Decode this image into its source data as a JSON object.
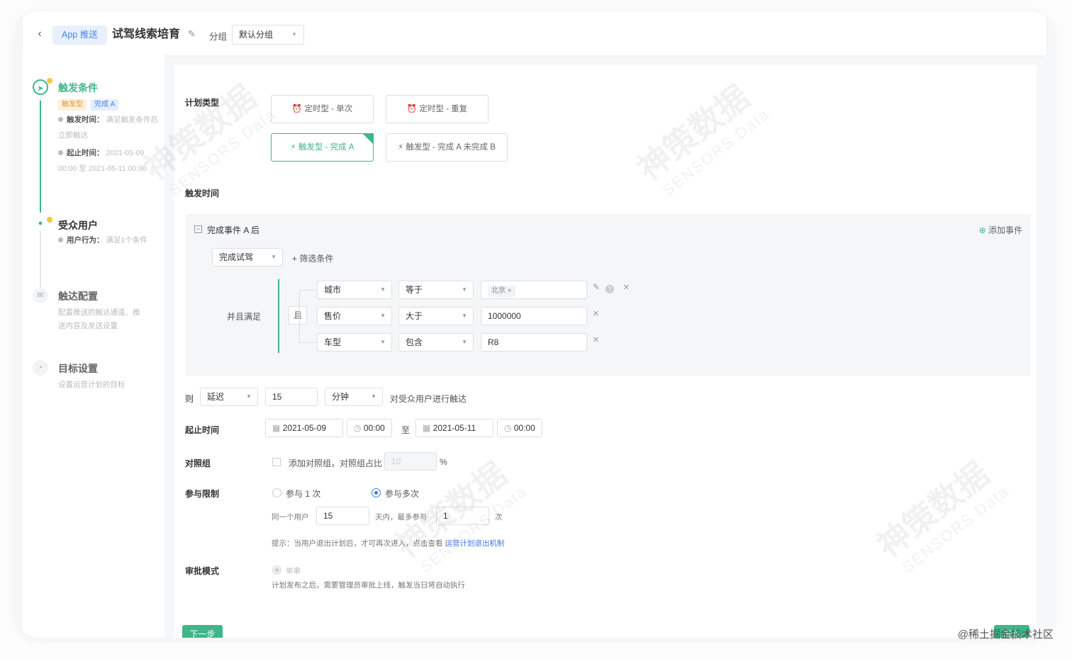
{
  "header": {
    "channel": "App 推送",
    "title": "试驾线索培育",
    "group_label": "分组",
    "group_value": "默认分组"
  },
  "steps": {
    "trigger": {
      "title": "触发条件",
      "badge1": "触发型",
      "badge2": "完成 A",
      "time_key": "触发时间：",
      "time_val": "满足触发条件后",
      "time_val2": "立即触达",
      "range_key": "起止时间：",
      "range_val": "2021-05-09",
      "range_val2": "00:00 至 2021-05-11 00:00"
    },
    "audience": {
      "title": "受众用户",
      "behavior_key": "用户行为：",
      "behavior_val": "满足1个条件"
    },
    "reach": {
      "title": "触达配置",
      "desc1": "配置推送的触达通道、推",
      "desc2": "送内容及发送设置"
    },
    "goal": {
      "title": "目标设置",
      "desc": "设置运营计划的目标"
    }
  },
  "form": {
    "plan_type_label": "计划类型",
    "plan_types": [
      "定时型 - 单次",
      "定时型 - 重复",
      "触发型 - 完成 A",
      "触发型 - 完成 A 未完成 B"
    ],
    "trigger_time_label": "触发时间",
    "cond": {
      "title": "完成事件 A 后",
      "add_event": "添加事件",
      "event": "完成试驾",
      "add_filter": "+ 筛选条件",
      "and_label": "并且满足",
      "and_op": "且",
      "rows": [
        {
          "field": "城市",
          "op": "等于",
          "value": "北京"
        },
        {
          "field": "售价",
          "op": "大于",
          "value": "1000000"
        },
        {
          "field": "车型",
          "op": "包含",
          "value": "R8"
        }
      ]
    },
    "then": {
      "label": "则",
      "mode": "延迟",
      "amount": "15",
      "unit": "分钟",
      "suffix": "对受众用户进行触达"
    },
    "range": {
      "label": "起止时间",
      "start_date": "2021-05-09",
      "start_time": "00:00",
      "to": "至",
      "end_date": "2021-05-11",
      "end_time": "00:00"
    },
    "control": {
      "label": "对照组",
      "text": "添加对照组，对照组占比",
      "value": "10",
      "unit": "%"
    },
    "limit": {
      "label": "参与限制",
      "once": "参与 1 次",
      "many": "参与多次",
      "same_user": "同一个用户",
      "days": "15",
      "days_text": "天内，最多参与",
      "times": "1",
      "times_unit": "次",
      "hint": "提示：当用户退出计划后，才可再次进入，点击查看",
      "hint_link": "运营计划退出机制"
    },
    "approval": {
      "label": "审批模式",
      "option": "单审",
      "desc": "计划发布之后，需要管理员审批上线，触发当日将自动执行"
    }
  },
  "buttons": {
    "next": "下一步",
    "publish": "发布"
  },
  "watermark": {
    "brand": "神策数据",
    "sub": "SENSORS Data"
  },
  "credit": "@稀土掘金技术社区",
  "colors": {
    "primary": "#3fb688",
    "accent_blue": "#3f7ce0",
    "badge_orange": "#f3a43c"
  }
}
